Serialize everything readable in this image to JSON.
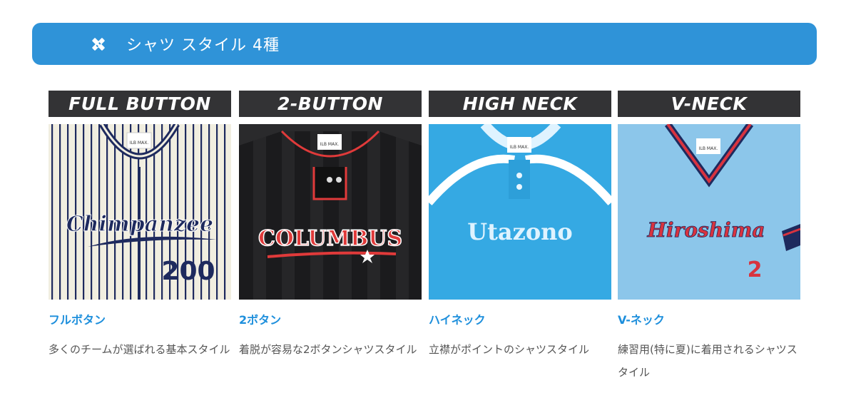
{
  "banner": {
    "icon": "pencil-ruler-icon",
    "title": "シャツ スタイル 4種"
  },
  "cards": [
    {
      "header": "FULL BUTTON",
      "name": "フルボタン",
      "description": "多くのチームが選ばれる基本スタイル",
      "jersey": {
        "script": "Chimpanzee",
        "number": "200",
        "tag": "ILB MAX.",
        "style": "full-button pinstripe",
        "body_color": "#f1eee0",
        "trim_color": "#1e2a5e"
      }
    },
    {
      "header": "2-BUTTON",
      "name": "2ボタン",
      "description": "着脱が容易な2ボタンシャツスタイル",
      "jersey": {
        "script": "COLUMBUS",
        "number": "",
        "tag": "ILB MAX.",
        "style": "two-button",
        "body_color": "#1b1b1d",
        "trim_color": "#e03a3a"
      }
    },
    {
      "header": "HIGH NECK",
      "name": "ハイネック",
      "description": "立襟がポイントのシャツスタイル",
      "jersey": {
        "script": "Utazono",
        "number": "",
        "tag": "ILB MAX.",
        "style": "high-neck",
        "body_color": "#35a9e3",
        "trim_color": "#ffffff"
      }
    },
    {
      "header": "V-NECK",
      "name": "V-ネック",
      "description": "練習用(特に夏)に着用されるシャツスタイル",
      "jersey": {
        "script": "Hiroshima",
        "number": "2",
        "tag": "ILB MAX.",
        "style": "v-neck",
        "body_color": "#8cc6ea",
        "trim_color": "#d8333f"
      }
    }
  ]
}
